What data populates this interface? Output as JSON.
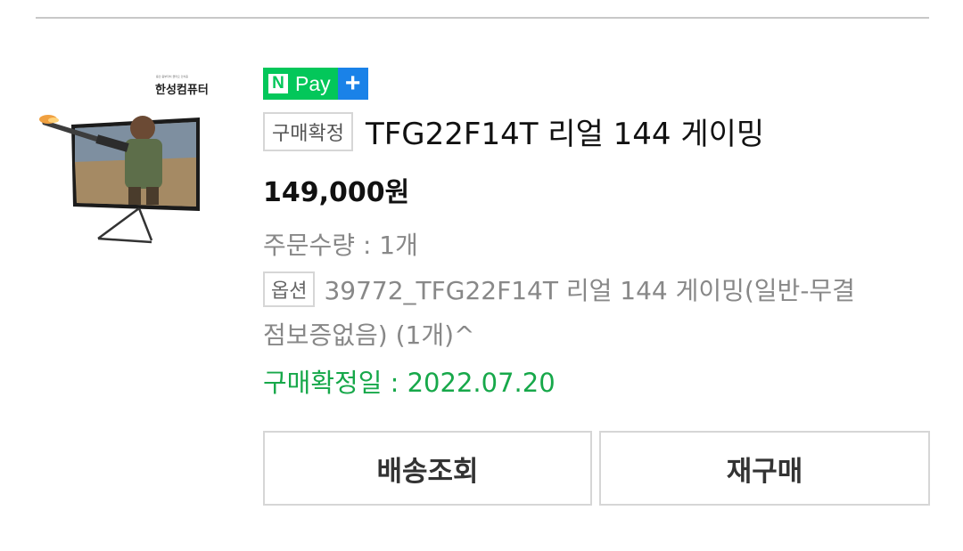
{
  "seller": {
    "tagline": "용인 중부자치 클리오 인식증",
    "name": "한성컴퓨터",
    "thumbnail_icon": "gaming-monitor-image"
  },
  "npay": {
    "n_label": "N",
    "pay_label": "Pay",
    "plus_label": "+",
    "colors": {
      "green": "#03c75a",
      "blue": "#1a82e8"
    }
  },
  "order": {
    "status_badge": "구매확정",
    "product_title": "TFG22F14T 리얼 144 게이밍",
    "price": "149,000원",
    "quantity": "주문수량 : 1개",
    "option_badge": "옵션",
    "option_line1": "39772_TFG22F14T 리얼 144 게이밍(일반-무결",
    "option_line2": "점보증없음) (1개)^",
    "confirm_date": "구매확정일 : 2022.07.20",
    "confirm_color": "#17a84a"
  },
  "actions": {
    "track_label": "배송조회",
    "rebuy_label": "재구매"
  }
}
